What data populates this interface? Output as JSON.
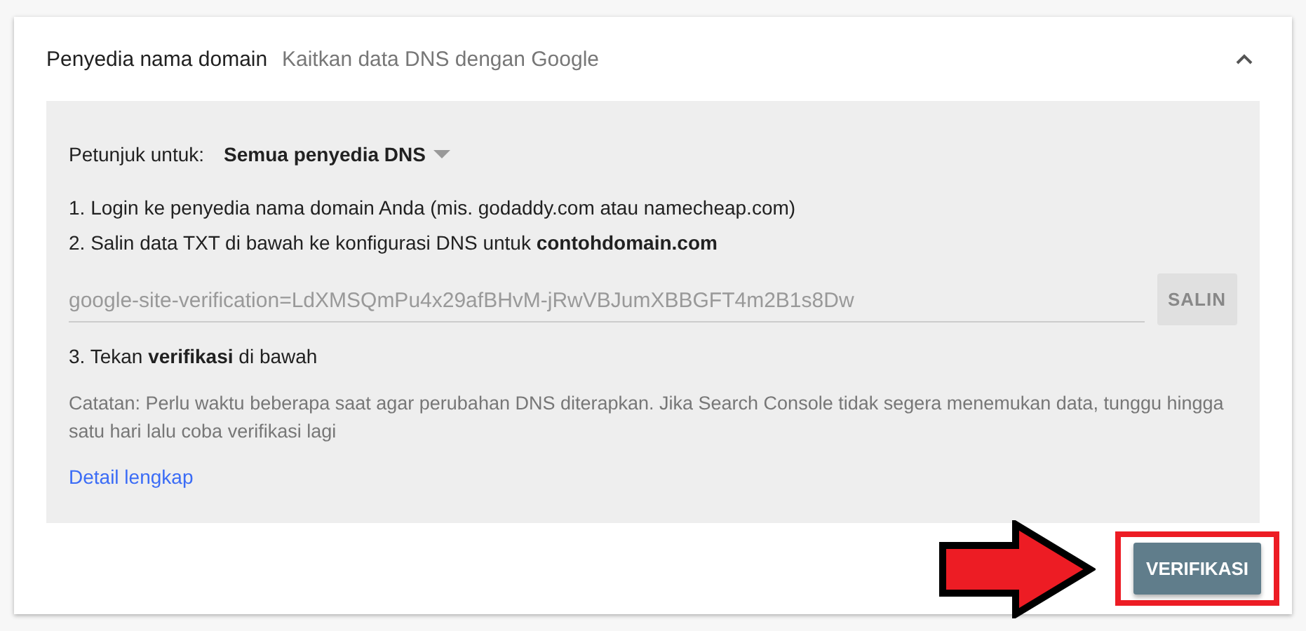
{
  "section": {
    "title": "Penyedia nama domain",
    "subtitle": "Kaitkan data DNS dengan Google",
    "expanded": true
  },
  "instructions": {
    "label": "Petunjuk untuk:",
    "provider": "Semua penyedia DNS"
  },
  "steps": [
    "1. Login ke penyedia nama domain Anda (mis. godaddy.com atau namecheap.com)",
    "2. Salin data TXT di bawah ke konfigurasi DNS untuk **contohdomain.com**"
  ],
  "txt_record": {
    "value": "google-site-verification=LdXMSQmPu4x29afBHvM-jRwVBJumXBBGFT4m2B1s8Dw",
    "copy_button": "SALIN",
    "copy_disabled": true
  },
  "final_step": "3. Tekan **verifikasi** di bawah",
  "note": "Catatan: Perlu waktu beberapa saat agar perubahan DNS diterapkan. Jika Search Console tidak segera menemukan data, tunggu hingga satu hari lalu coba verifikasi lagi",
  "details_link": "Detail lengkap",
  "verify_button": "VERIFIKASI"
}
